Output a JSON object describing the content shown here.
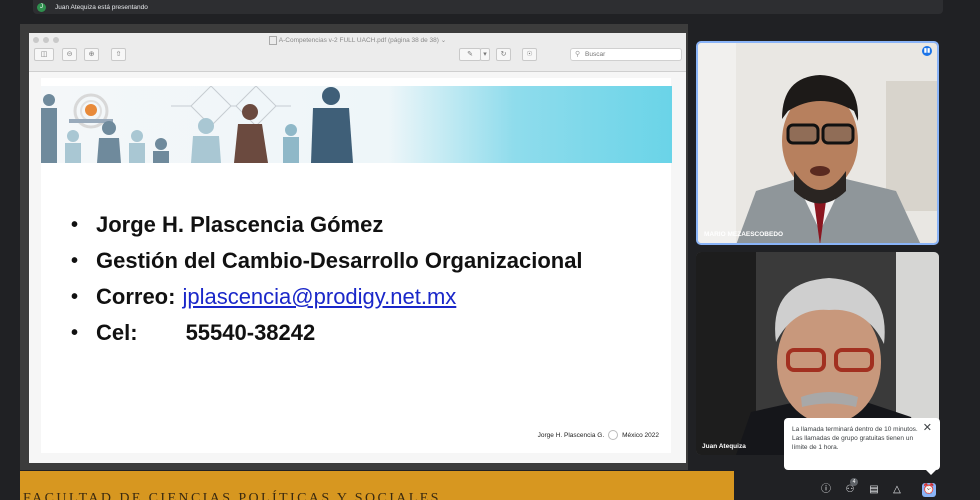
{
  "meeting": {
    "presenter_initial": "J",
    "presenter_text": "Juan Atequiza está presentando"
  },
  "viewer": {
    "title": "A-Competencias v-2 FULL UACH.pdf (página 38 de 38)",
    "search_placeholder": "Buscar",
    "icons": [
      "sidebar-icon",
      "zoom-out-icon",
      "zoom-in-icon",
      "share-icon",
      "pen-icon",
      "chevron-down-icon",
      "rotate-icon",
      "markup-icon",
      "search-icon"
    ]
  },
  "slide": {
    "bullets": [
      {
        "text": "Jorge H. Plascencia Gómez"
      },
      {
        "text": "Gestión del Cambio-Desarrollo Organizacional"
      },
      {
        "label": "Correo:",
        "value": "jplascencia@prodigy.net.mx"
      },
      {
        "label": "Cel:",
        "value": "55540-38242"
      }
    ],
    "footer_author": "Jorge H. Plascencia G.",
    "footer_place": "México 2022",
    "colors": {
      "banner_cyan": "#6ad4e8",
      "email_link": "#1a27c9"
    }
  },
  "participants": [
    {
      "name": "MARIO MEZAESCOBEDO",
      "speaking": true
    },
    {
      "name": "Juan Atequiza",
      "speaking": false
    }
  ],
  "notification": {
    "message": "La llamada terminará dentro de 10 minutos. Las llamadas de grupo gratuitas tienen un límite de 1 hora."
  },
  "lower_banner": {
    "text": "FACULTAD DE CIENCIAS POLÍTICAS Y SOCIALES",
    "color": "#d79720"
  },
  "controls": {
    "participants_count": "4",
    "icons": [
      "info-icon",
      "people-icon",
      "chat-icon",
      "activities-icon",
      "timer-icon"
    ]
  },
  "theme": {
    "accent": "#8ab4f8",
    "background": "#202124"
  }
}
